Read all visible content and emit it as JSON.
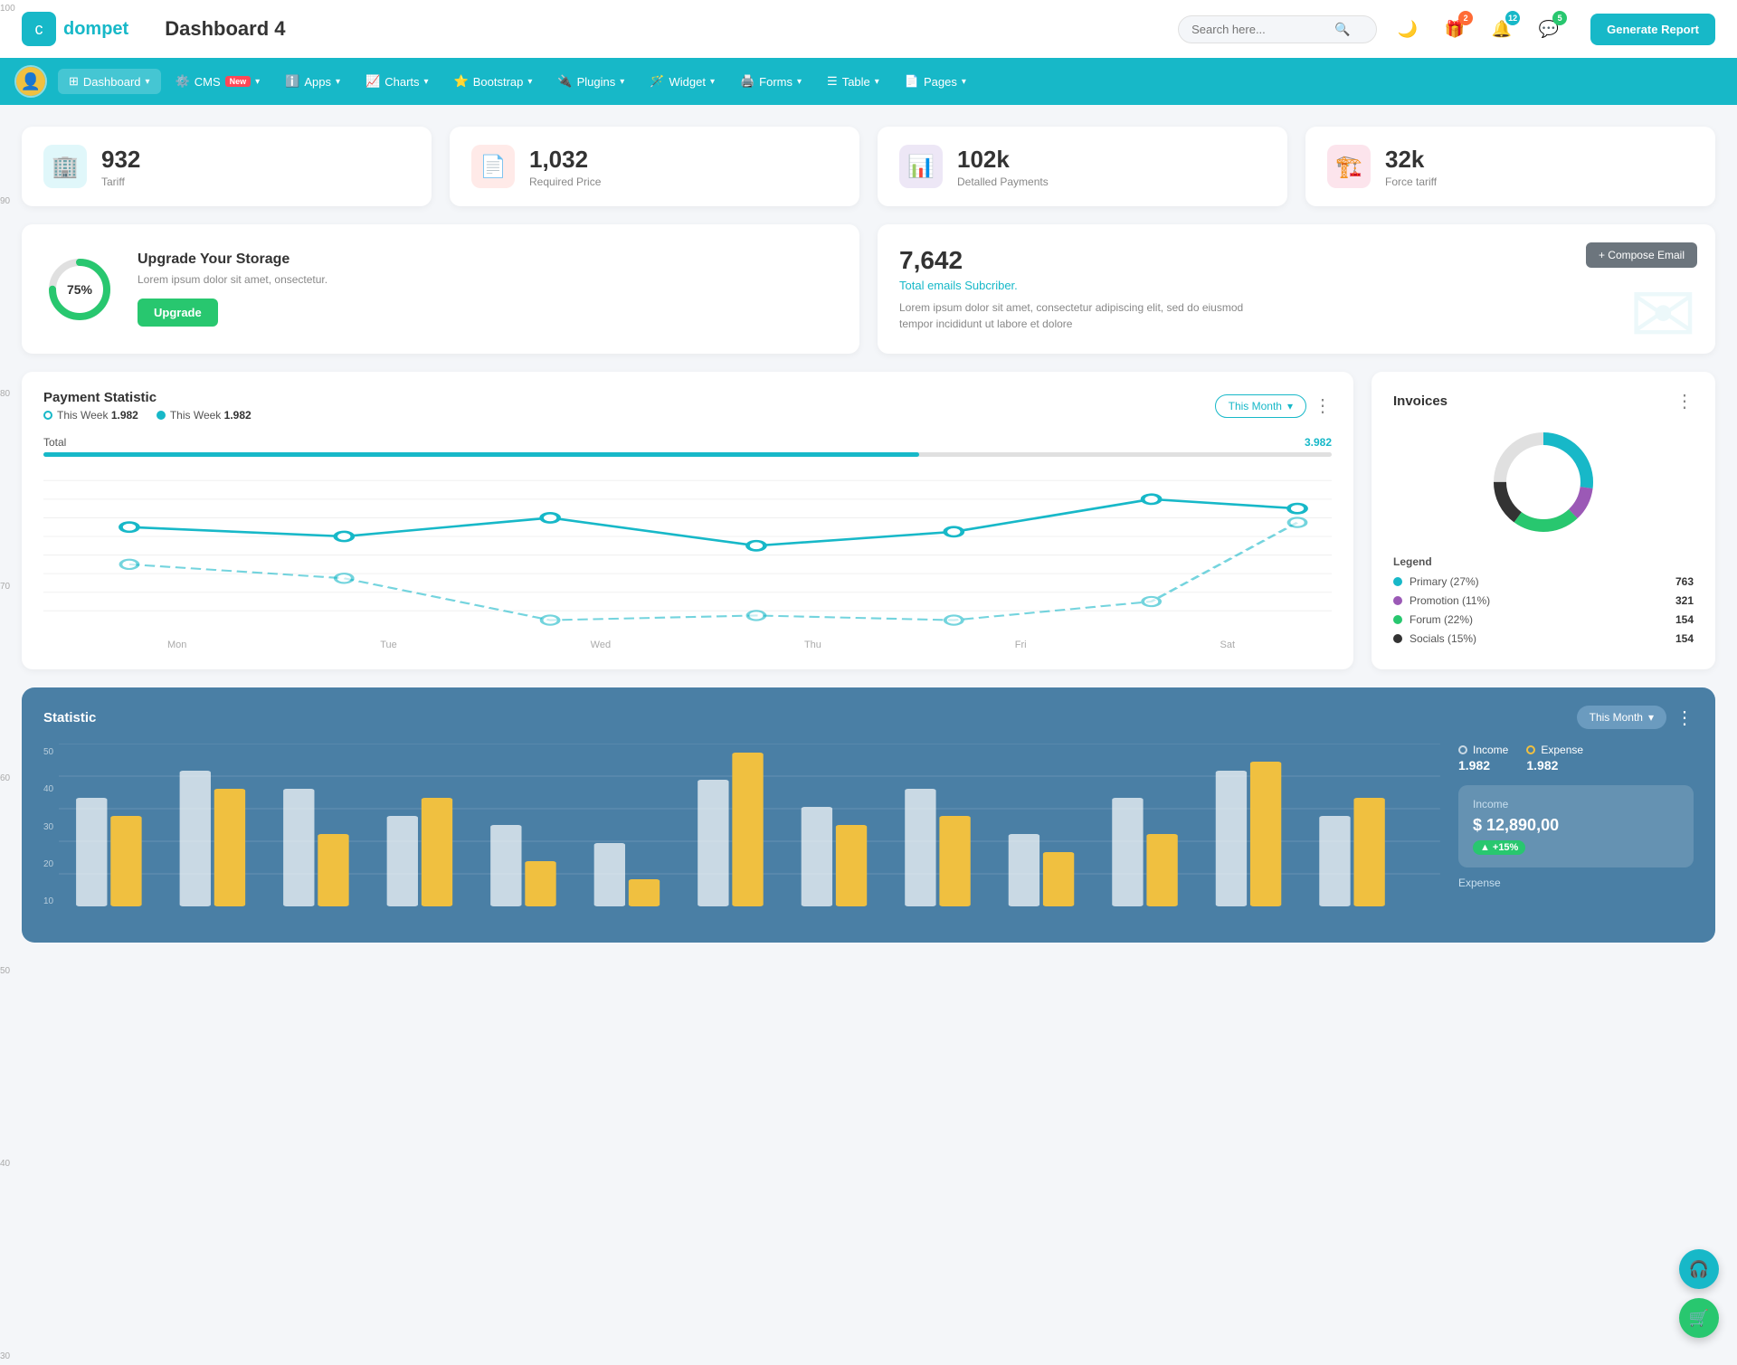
{
  "header": {
    "logo_icon": "💼",
    "logo_text": "dompet",
    "page_title": "Dashboard 4",
    "search_placeholder": "Search here...",
    "generate_btn": "Generate Report",
    "icons": {
      "moon": "🌙",
      "gift_badge": "2",
      "bell_badge": "12",
      "chat_badge": "5"
    }
  },
  "nav": {
    "items": [
      {
        "label": "Dashboard",
        "active": true,
        "has_arrow": true
      },
      {
        "label": "CMS",
        "badge": "New",
        "has_arrow": true
      },
      {
        "label": "Apps",
        "has_arrow": true
      },
      {
        "label": "Charts",
        "has_arrow": true
      },
      {
        "label": "Bootstrap",
        "has_arrow": true
      },
      {
        "label": "Plugins",
        "has_arrow": true
      },
      {
        "label": "Widget",
        "has_arrow": true
      },
      {
        "label": "Forms",
        "has_arrow": true
      },
      {
        "label": "Table",
        "has_arrow": true
      },
      {
        "label": "Pages",
        "has_arrow": true
      }
    ]
  },
  "stat_cards": [
    {
      "value": "932",
      "label": "Tariff",
      "icon_type": "teal",
      "icon": "🏢"
    },
    {
      "value": "1,032",
      "label": "Required Price",
      "icon_type": "red",
      "icon": "📄"
    },
    {
      "value": "102k",
      "label": "Detalled Payments",
      "icon_type": "purple",
      "icon": "📊"
    },
    {
      "value": "32k",
      "label": "Force tariff",
      "icon_type": "pink",
      "icon": "🏗️"
    }
  ],
  "storage": {
    "percent": "75%",
    "title": "Upgrade Your Storage",
    "description": "Lorem ipsum dolor sit amet, onsectetur.",
    "btn_label": "Upgrade",
    "donut_value": 75
  },
  "email": {
    "number": "7,642",
    "subtitle": "Total emails Subcriber.",
    "description": "Lorem ipsum dolor sit amet, consectetur adipiscing elit, sed do eiusmod tempor incididunt ut labore et dolore",
    "compose_btn": "+ Compose Email"
  },
  "payment": {
    "title": "Payment Statistic",
    "legend1_label": "This Week",
    "legend1_val": "1.982",
    "legend2_label": "This Week",
    "legend2_val": "1.982",
    "month_btn": "This Month",
    "more_btn": "⋮",
    "total_label": "Total",
    "total_val": "3.982",
    "x_labels": [
      "Mon",
      "Tue",
      "Wed",
      "Thu",
      "Fri",
      "Sat"
    ],
    "y_labels": [
      "100",
      "90",
      "80",
      "70",
      "60",
      "50",
      "40",
      "30"
    ],
    "line1_points": "45,135 155,115 265,105 375,75 485,120 595,55 700,65",
    "line2_points": "45,160 155,150 265,158 375,155 485,158 595,140 700,60"
  },
  "invoices": {
    "title": "Invoices",
    "more_btn": "⋮",
    "legend_title": "Legend",
    "items": [
      {
        "label": "Primary (27%)",
        "color": "#17b8c8",
        "val": "763"
      },
      {
        "label": "Promotion (11%)",
        "color": "#9b59b6",
        "val": "321"
      },
      {
        "label": "Forum (22%)",
        "color": "#28c76f",
        "val": "154"
      },
      {
        "label": "Socials (15%)",
        "color": "#333",
        "val": "154"
      }
    ]
  },
  "statistic": {
    "title": "Statistic",
    "month_btn": "This Month",
    "income_label": "Income",
    "income_val": "1.982",
    "expense_label": "Expense",
    "expense_val": "1.982",
    "income_box_label": "Income",
    "income_box_val": "$ 12,890,00",
    "income_badge": "+15%",
    "expense_text": "Expense",
    "y_labels": [
      "50",
      "40",
      "30",
      "20",
      "10"
    ]
  },
  "float_btns": {
    "headset_icon": "🎧",
    "cart_icon": "🛒"
  }
}
